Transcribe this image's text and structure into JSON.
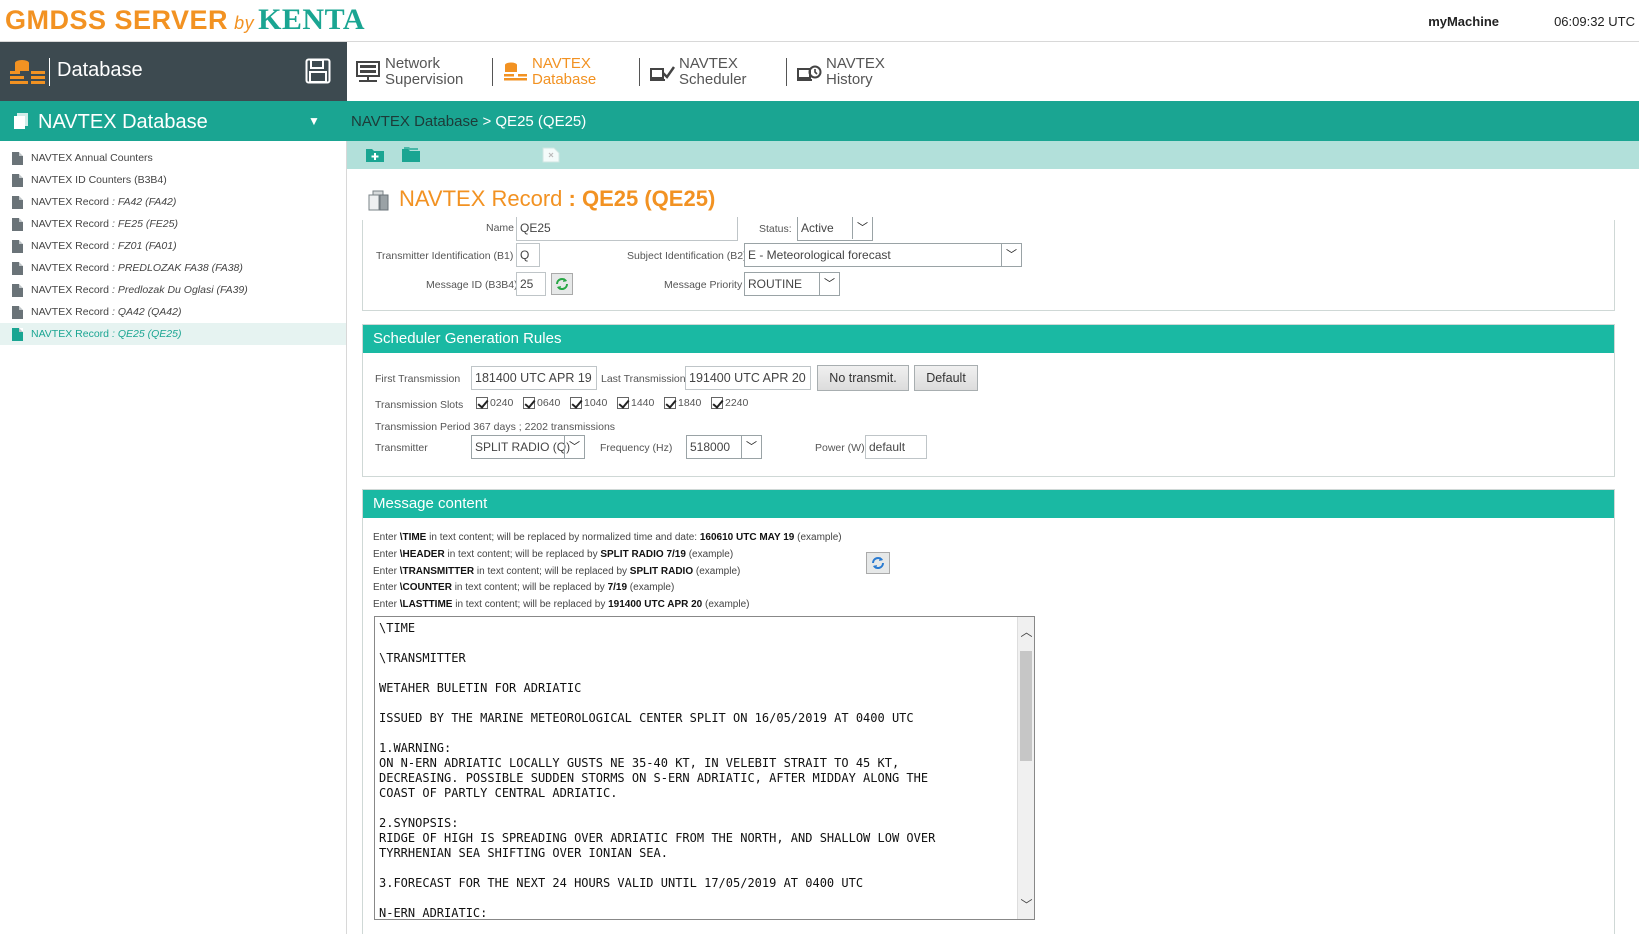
{
  "app": {
    "logo_part1": "GMDSS SERVER",
    "logo_part2": "by",
    "logo_part3": "KENTA",
    "machine": "myMachine",
    "clock": "06:09:32 UTC"
  },
  "sidebar_header": {
    "title": "Database"
  },
  "nav": {
    "items": [
      {
        "label": "Network\nSupervision",
        "active": false
      },
      {
        "label": "NAVTEX\nDatabase",
        "active": true
      },
      {
        "label": "NAVTEX\nScheduler",
        "active": false
      },
      {
        "label": "NAVTEX\nHistory",
        "active": false
      }
    ]
  },
  "sidebar": {
    "section_title": "NAVTEX Database",
    "items": [
      {
        "label": "NAVTEX Annual Counters",
        "record": ""
      },
      {
        "label": "NAVTEX ID Counters (B3B4)",
        "record": ""
      },
      {
        "label": "NAVTEX Record",
        "record": ": FA42 (FA42)"
      },
      {
        "label": "NAVTEX Record",
        "record": ": FE25 (FE25)"
      },
      {
        "label": "NAVTEX Record",
        "record": ": FZ01 (FA01)"
      },
      {
        "label": "NAVTEX Record",
        "record": ": PREDLOZAK FA38 (FA38)"
      },
      {
        "label": "NAVTEX Record",
        "record": ": Predlozak Du Oglasi (FA39)"
      },
      {
        "label": "NAVTEX Record",
        "record": ": QA42 (QA42)"
      },
      {
        "label": "NAVTEX Record",
        "record": ": QE25 (QE25)"
      }
    ]
  },
  "breadcrumb": {
    "root": "NAVTEX Database",
    "current": "QE25 (QE25)"
  },
  "record": {
    "title_prefix": "NAVTEX Record",
    "title_name": ": QE25 (QE25)",
    "name_label": "Name",
    "name_value": "QE25",
    "status_label": "Status:",
    "status_value": "Active",
    "tx_id_label": "Transmitter Identification (B1)",
    "tx_id_value": "Q",
    "subject_label": "Subject Identification (B2)",
    "subject_value": "E - Meteorological forecast",
    "msgid_label": "Message ID (B3B4)",
    "msgid_value": "25",
    "priority_label": "Message Priority",
    "priority_value": "ROUTINE"
  },
  "scheduler": {
    "title": "Scheduler Generation Rules",
    "first_label": "First Transmission",
    "first_value": "181400 UTC APR 19",
    "last_label": "Last Transmission",
    "last_value": "191400 UTC APR 20",
    "no_transmit": "No transmit.",
    "default_btn": "Default",
    "slots_label": "Transmission Slots",
    "slots": [
      "0240",
      "0640",
      "1040",
      "1440",
      "1840",
      "2240"
    ],
    "period_label": "Transmission Period",
    "period_value": "367 days ; 2202 transmissions",
    "transmitter_label": "Transmitter",
    "transmitter_value": "SPLIT RADIO (Q)",
    "freq_label": "Frequency (Hz)",
    "freq_value": "518000",
    "power_label": "Power (W)",
    "power_value": "default"
  },
  "message": {
    "title": "Message content",
    "help": [
      {
        "pre": "Enter ",
        "code": "\\TIME",
        "mid": " in text content; will be replaced by normalized time and date: ",
        "example": "160610 UTC MAY 19",
        "post": " (example)"
      },
      {
        "pre": "Enter ",
        "code": "\\HEADER",
        "mid": " in text content; will be replaced by ",
        "example": "SPLIT RADIO 7/19",
        "post": " (example)"
      },
      {
        "pre": "Enter ",
        "code": "\\TRANSMITTER",
        "mid": " in text content; will be replaced by ",
        "example": "SPLIT RADIO",
        "post": " (example)"
      },
      {
        "pre": "Enter ",
        "code": "\\COUNTER",
        "mid": " in text content; will be replaced by ",
        "example": "7/19",
        "post": " (example)"
      },
      {
        "pre": "Enter ",
        "code": "\\LASTTIME",
        "mid": " in text content; will be replaced by ",
        "example": "191400 UTC APR 20",
        "post": " (example)"
      }
    ],
    "body": "\\TIME\n\n\\TRANSMITTER\n\nWETAHER BULETIN FOR ADRIATIC\n\nISSUED BY THE MARINE METEOROLOGICAL CENTER SPLIT ON 16/05/2019 AT 0400 UTC\n\n1.WARNING:\nON N-ERN ADRIATIC LOCALLY GUSTS NE 35-40 KT, IN VELEBIT STRAIT TO 45 KT,\nDECREASING. POSSIBLE SUDDEN STORMS ON S-ERN ADRIATIC, AFTER MIDDAY ALONG THE\nCOAST OF PARTLY CENTRAL ADRIATIC.\n\n2.SYNOPSIS:\nRIDGE OF HIGH IS SPREADING OVER ADRIATIC FROM THE NORTH, AND SHALLOW LOW OVER\nTYRRHENIAN SEA SHIFTING OVER IONIAN SEA.\n\n3.FORECAST FOR THE NEXT 24 HOURS VALID UNTIL 17/05/2019 AT 0400 UTC\n\nN-ERN ADRIATIC:"
  },
  "colors": {
    "accent_orange": "#f29222",
    "teal": "#1aa592",
    "dark_header": "#3d4a50"
  }
}
